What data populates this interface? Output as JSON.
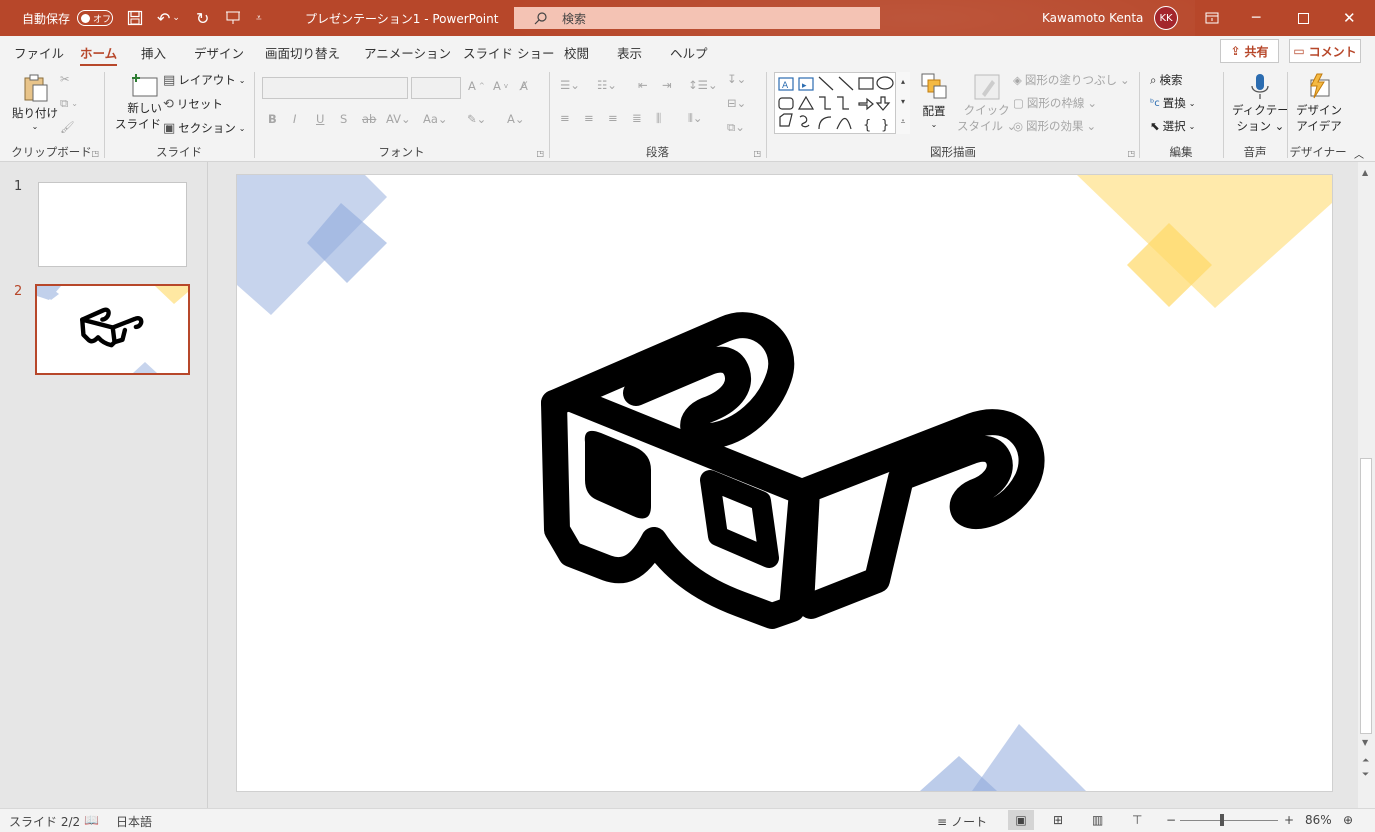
{
  "titlebar": {
    "autosave_label": "自動保存",
    "autosave_state": "オフ",
    "document_title": "プレゼンテーション1  -  PowerPoint",
    "search_placeholder": "検索",
    "user_name": "Kawamoto Kenta",
    "user_initials": "KK"
  },
  "tabs": [
    "ファイル",
    "ホーム",
    "挿入",
    "デザイン",
    "画面切り替え",
    "アニメーション",
    "スライド ショー",
    "校閲",
    "表示",
    "ヘルプ"
  ],
  "active_tab": "ホーム",
  "share_label": "共有",
  "comment_label": "コメント",
  "ribbon": {
    "clipboard": {
      "paste": "貼り付け",
      "label": "クリップボード"
    },
    "slides": {
      "new_slide_1": "新しい",
      "new_slide_2": "スライド",
      "layout": "レイアウト",
      "reset": "リセット",
      "section": "セクション",
      "label": "スライド"
    },
    "font": {
      "label": "フォント"
    },
    "paragraph": {
      "label": "段落"
    },
    "drawing": {
      "arrange": "配置",
      "quick_style_1": "クイック",
      "quick_style_2": "スタイル",
      "fill": "図形の塗りつぶし",
      "outline": "図形の枠線",
      "effects": "図形の効果",
      "label": "図形描画"
    },
    "editing": {
      "find": "検索",
      "replace": "置換",
      "select": "選択",
      "label": "編集"
    },
    "voice": {
      "dictate_1": "ディクテー",
      "dictate_2": "ション",
      "label": "音声"
    },
    "designer": {
      "ideas_1": "デザイン",
      "ideas_2": "アイデア",
      "label": "デザイナー"
    }
  },
  "slides_panel": [
    {
      "number": "1",
      "selected": false
    },
    {
      "number": "2",
      "selected": true
    }
  ],
  "statusbar": {
    "slide_indicator": "スライド 2/2",
    "language": "日本語",
    "notes": "ノート",
    "zoom": "86%"
  },
  "colors": {
    "accent": "#b7472a",
    "blue_shape": "#8faadc",
    "yellow_shape": "#ffd966"
  },
  "icons": {
    "slide_content": "3d-glasses-icon"
  }
}
